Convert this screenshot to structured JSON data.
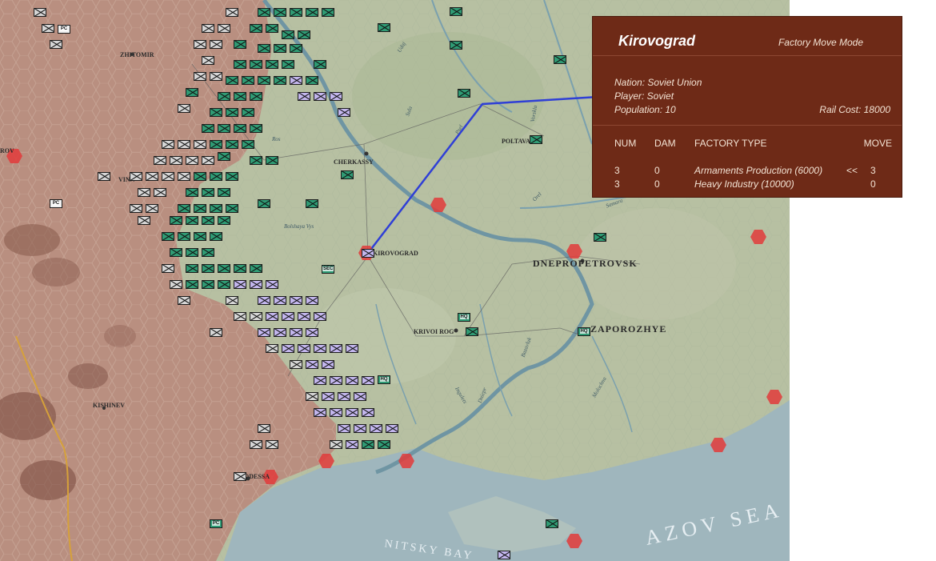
{
  "map": {
    "cities": [
      {
        "name": "ZHITOMIR"
      },
      {
        "name": "CHERKASSY"
      },
      {
        "name": "POLTAVA"
      },
      {
        "name": "KIROVOGRAD"
      },
      {
        "name": "DNEPROPETROVSK"
      },
      {
        "name": "KRIVOI ROG"
      },
      {
        "name": "ZAPOROZHYE"
      },
      {
        "name": "KISHINEV"
      },
      {
        "name": "ODESSA"
      },
      {
        "name": "ROV"
      },
      {
        "name": "VINN"
      }
    ],
    "seas": [
      {
        "name": "AZOV SEA"
      },
      {
        "name": "NITSKY BAY"
      }
    ],
    "rivers": [
      {
        "name": "Bolshaya Vys"
      },
      {
        "name": "Dniepr"
      },
      {
        "name": "Ingulets"
      },
      {
        "name": "Bazavluk"
      },
      {
        "name": "Molochna"
      },
      {
        "name": "Samara"
      },
      {
        "name": "Orel"
      },
      {
        "name": "Vorskla"
      },
      {
        "name": "Psel"
      },
      {
        "name": "Sula"
      },
      {
        "name": "Udaj"
      },
      {
        "name": "Ros"
      }
    ],
    "unit_labels": {
      "hq": "HQ",
      "sec": "SEC",
      "pc": "PC"
    }
  },
  "panel": {
    "city": "Kirovograd",
    "mode": "Factory Move Mode",
    "nation": "Nation: Soviet Union",
    "player": "Player: Soviet",
    "population": "Population: 10",
    "rail_cost": "Rail Cost: 18000",
    "headers": {
      "num": "NUM",
      "dam": "DAM",
      "type": "FACTORY TYPE",
      "move": "MOVE"
    },
    "factories": [
      {
        "num": "3",
        "dam": "0",
        "type": "Armaments Production (6000)",
        "arrow": "<<",
        "move": "3"
      },
      {
        "num": "3",
        "dam": "0",
        "type": "Heavy Industry (10000)",
        "arrow": "",
        "move": "0"
      }
    ]
  },
  "colors": {
    "panel_bg": "#6e2a17",
    "axis_hex": "#b08a7a",
    "steppe": "#b9c2a5",
    "sea": "#9fb6bd",
    "soviet_unit": "#2f9b74",
    "axis_unit": "#c3b6ee",
    "rail_line": "#2f3fd6",
    "objective_hex": "#e23b3b"
  }
}
